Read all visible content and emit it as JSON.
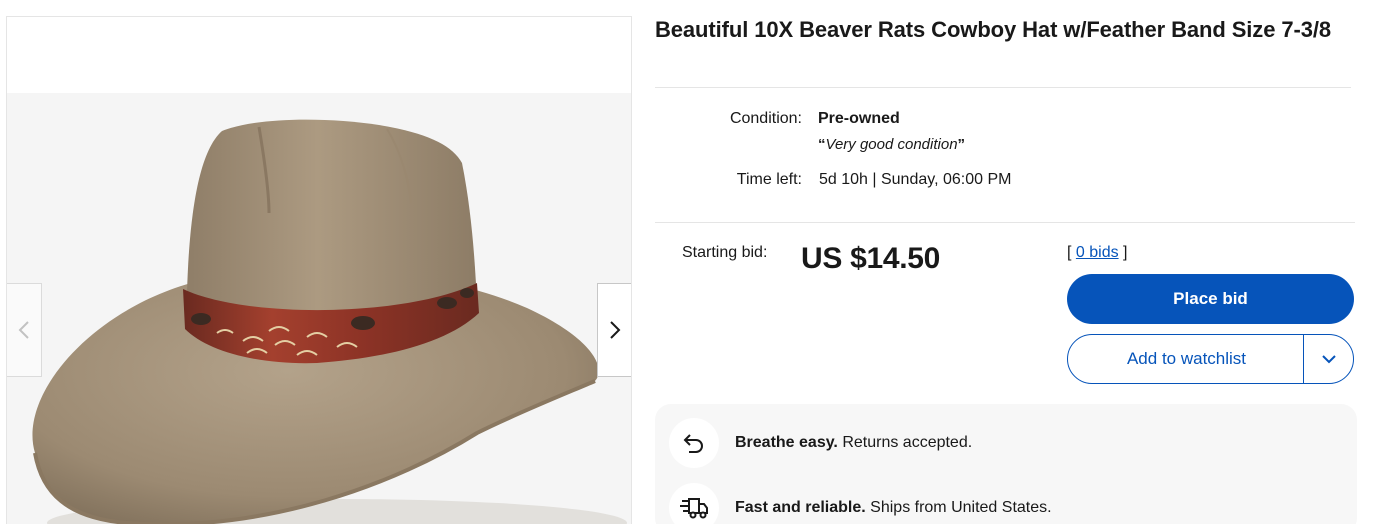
{
  "listing": {
    "title": "Beautiful 10X Beaver Rats Cowboy Hat w/Feather Band Size 7-3/8"
  },
  "gallery": {
    "prev_icon": "chevron-left-icon",
    "next_icon": "chevron-right-icon"
  },
  "details": {
    "condition_label": "Condition:",
    "condition_value": "Pre-owned",
    "condition_note": "Very good condition",
    "time_left_label": "Time left:",
    "time_left_value": "5d 10h | Sunday, 06:00 PM"
  },
  "bidding": {
    "starting_bid_label": "Starting bid:",
    "price": "US $14.50",
    "bids_prefix": "[ ",
    "bids_link": "0 bids",
    "bids_suffix": " ]",
    "place_bid_label": "Place bid",
    "watchlist_label": "Add to watchlist"
  },
  "promos": [
    {
      "icon": "return-arrow-icon",
      "bold": "Breathe easy.",
      "text": " Returns accepted."
    },
    {
      "icon": "delivery-truck-icon",
      "bold": "Fast and reliable.",
      "text": " Ships from United States."
    }
  ],
  "colors": {
    "accent": "#0654ba",
    "panel": "#f7f7f7",
    "hat_felt": "#a4927a",
    "feather_red": "#9e3a2a"
  }
}
